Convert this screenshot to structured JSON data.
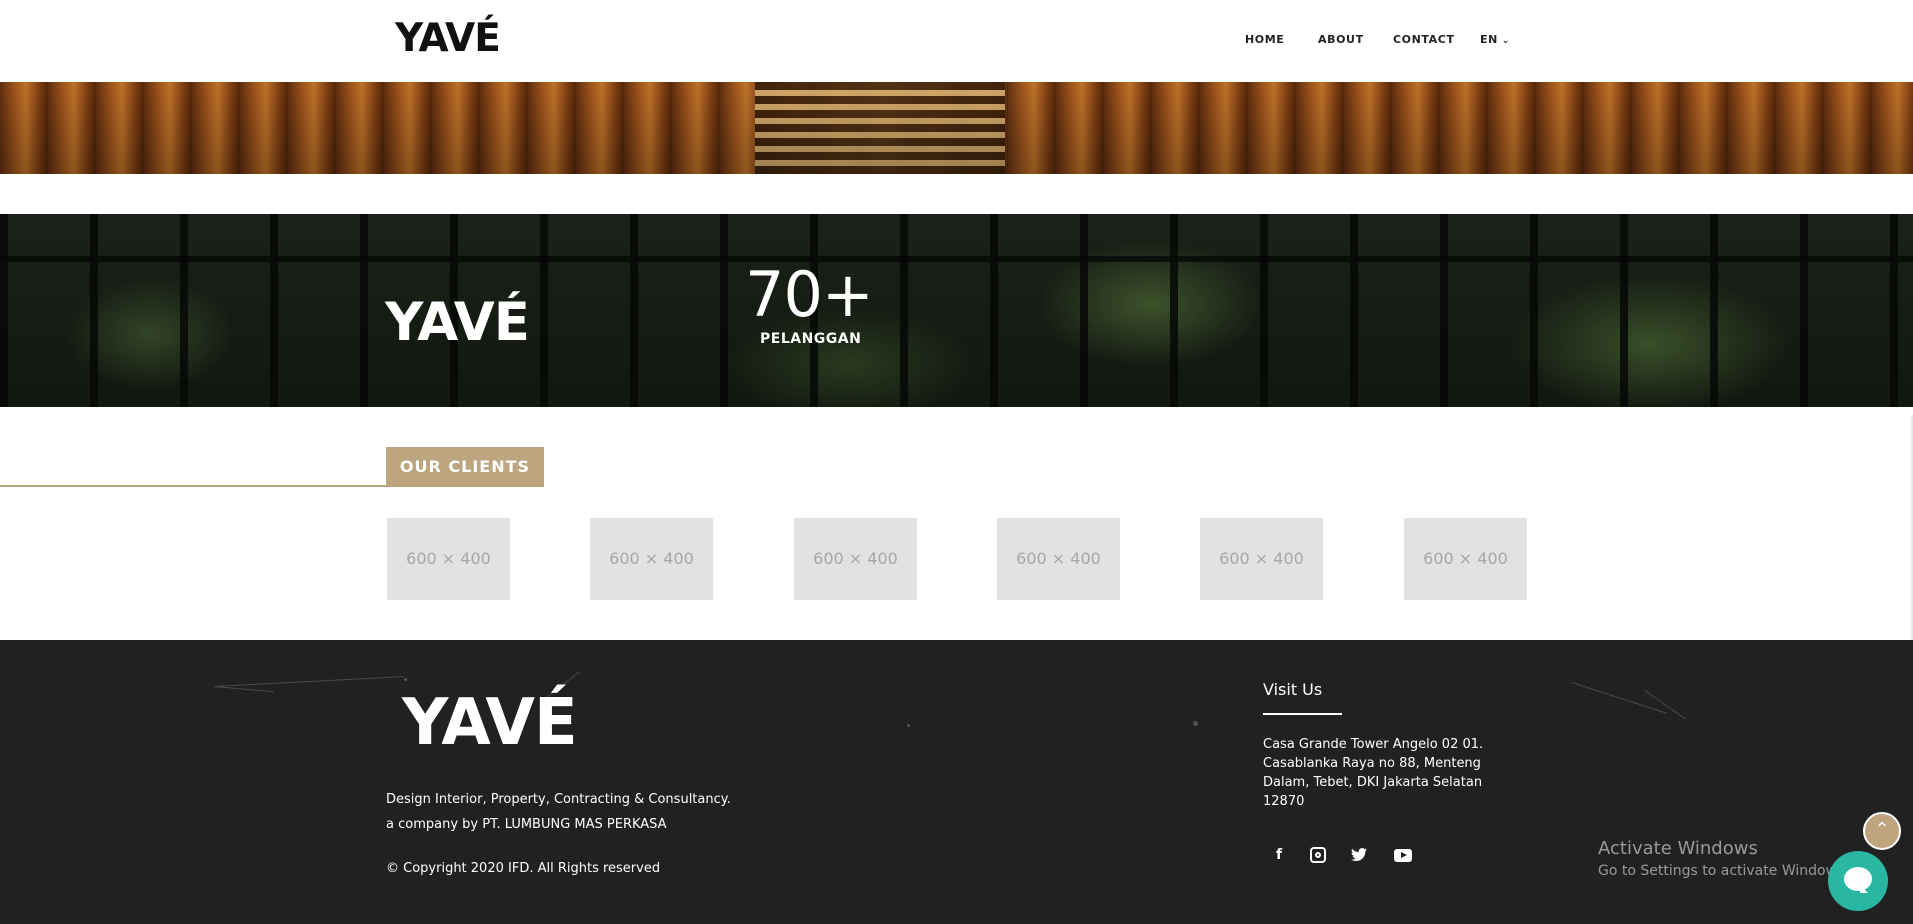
{
  "header": {
    "logo": "YAVÉ",
    "nav": [
      "HOME",
      "ABOUT",
      "CONTACT"
    ],
    "language": "EN",
    "language_icon": "chevron-down-icon"
  },
  "stats": {
    "logo": "YAVÉ",
    "number": "70+",
    "label": "PELANGGAN"
  },
  "clients": {
    "heading": "OUR CLIENTS",
    "logos": [
      "600 × 400",
      "600 × 400",
      "600 × 400",
      "600 × 400",
      "600 × 400",
      "600 × 400"
    ]
  },
  "footer": {
    "logo": "YAVÉ",
    "description": "Design Interior, Property, Contracting & Consultancy.",
    "company": "a company by PT. LUMBUNG MAS PERKASA",
    "copyright": "© Copyright 2020 IFD. All Rights reserved",
    "visit_title": "Visit Us",
    "address_lines": [
      "Casa Grande Tower Angelo 02 01.",
      "Casablanka Raya no 88, Menteng",
      "Dalam, Tebet, DKI Jakarta Selatan",
      "12870"
    ],
    "social_icons": [
      "facebook-icon",
      "instagram-icon",
      "twitter-icon",
      "youtube-icon"
    ]
  },
  "overlay": {
    "activate_title": "Activate Windows",
    "activate_sub": "Go to Settings to activate Windows."
  },
  "colors": {
    "accent": "#bca57f",
    "footer_bg": "#212121",
    "chat": "#29b7a4"
  }
}
